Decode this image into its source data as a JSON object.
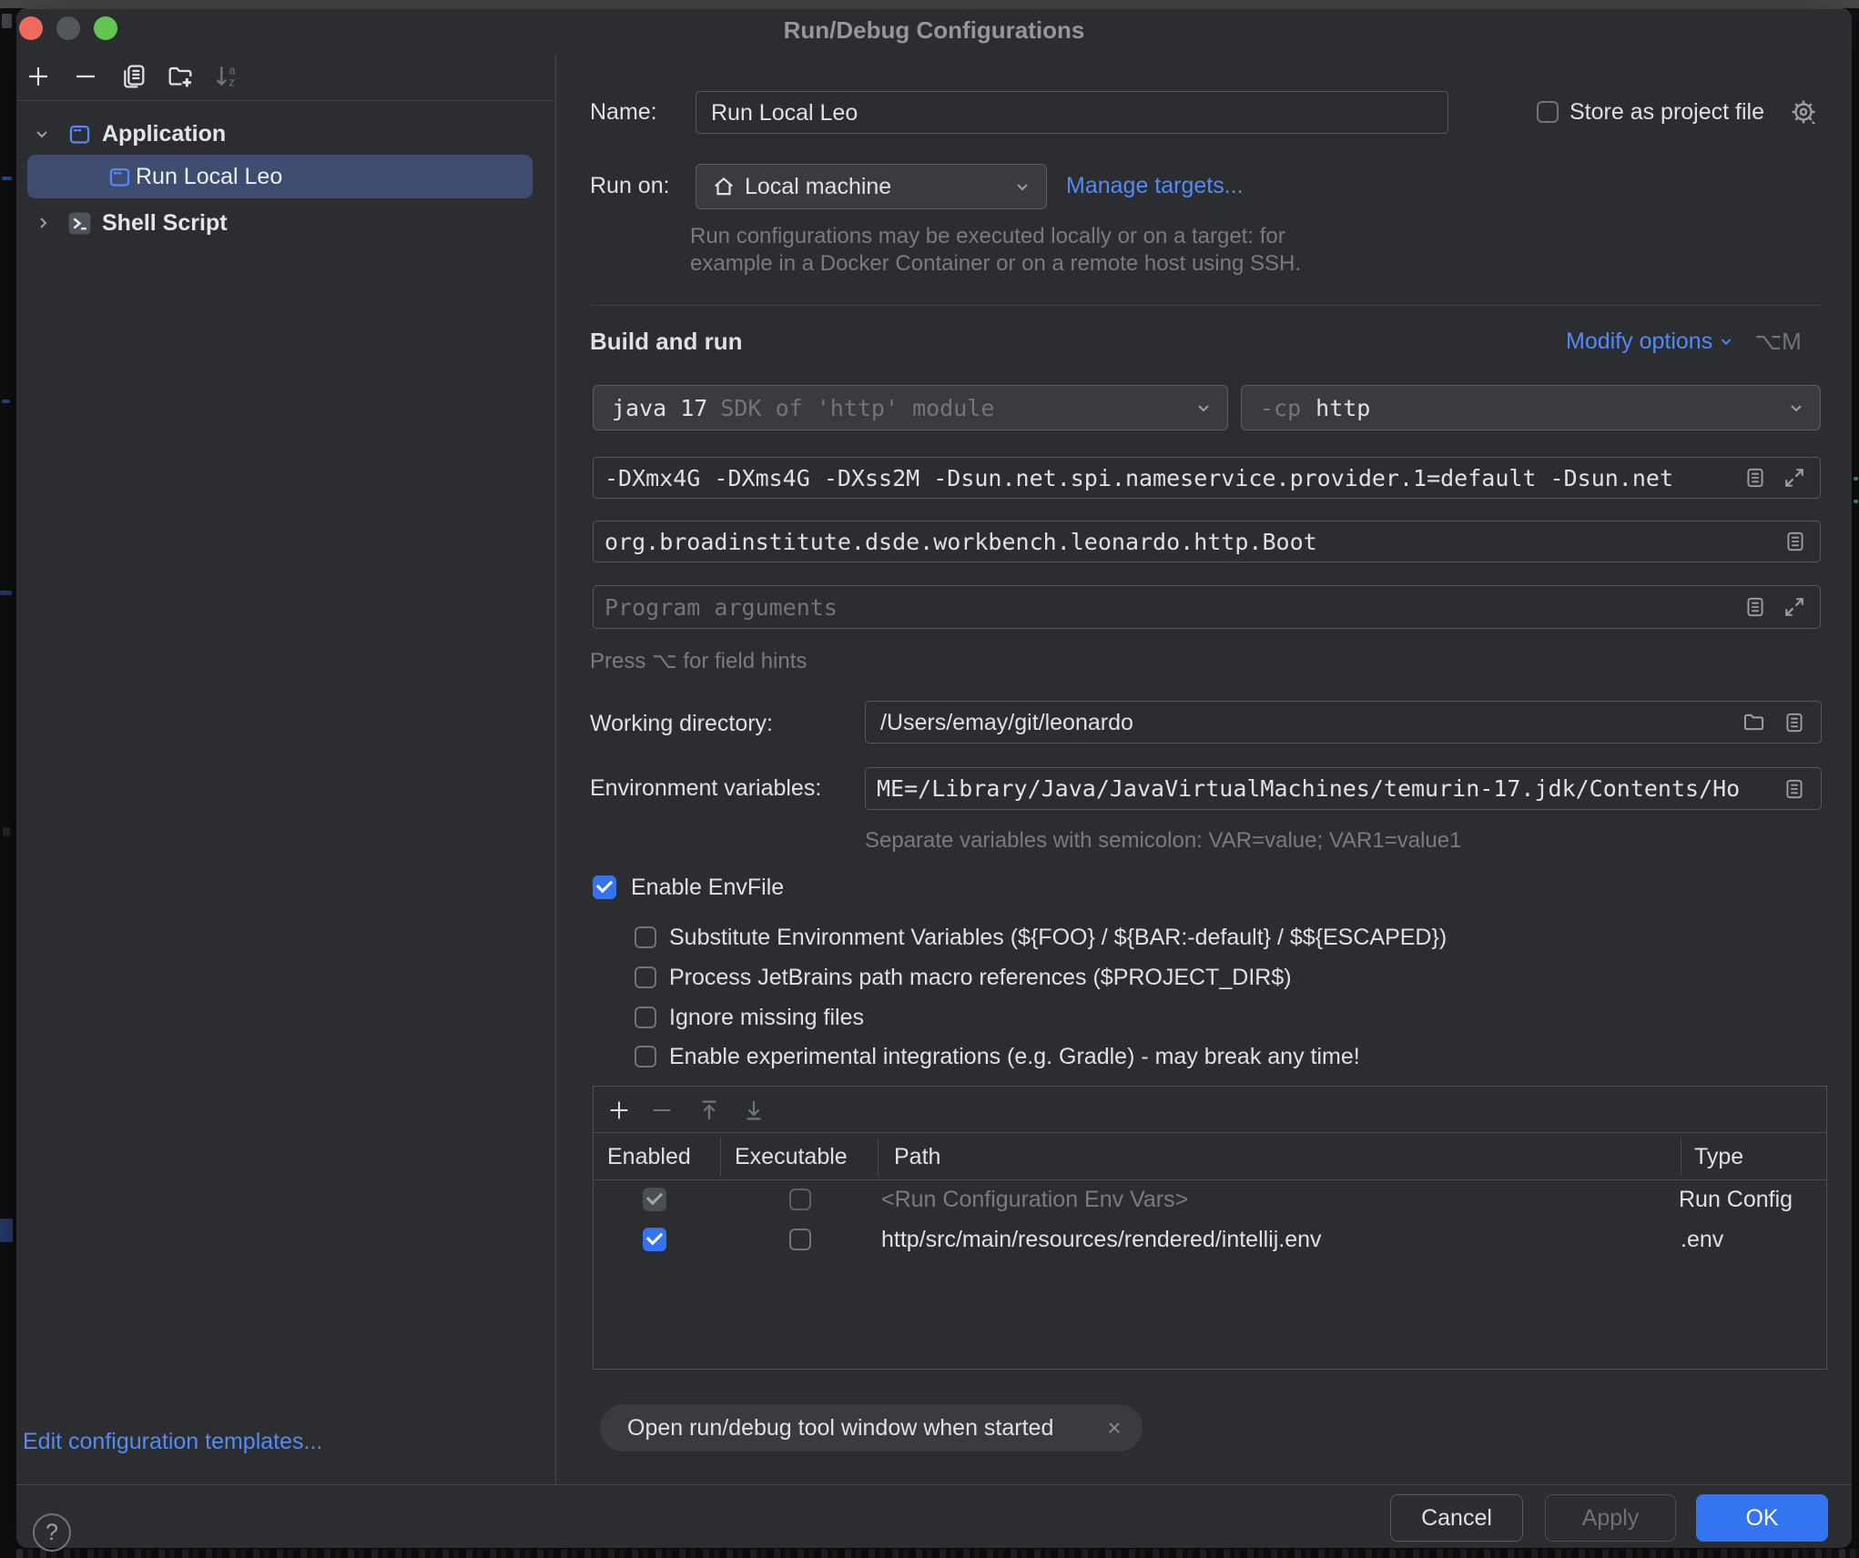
{
  "window": {
    "title": "Run/Debug Configurations",
    "traffic_lights": [
      "close",
      "minimize",
      "zoom"
    ]
  },
  "sidebar": {
    "toolbar": [
      {
        "icon": "add-icon"
      },
      {
        "icon": "remove-icon"
      },
      {
        "icon": "copy-icon"
      },
      {
        "icon": "new-folder-icon"
      },
      {
        "icon": "sort-alphabetically-icon"
      }
    ],
    "tree": [
      {
        "label": "Application",
        "icon": "application-icon",
        "expanded": true
      },
      {
        "label": "Run Local Leo",
        "icon": "application-icon",
        "selected": true
      },
      {
        "label": "Shell Script",
        "icon": "shell-script-icon",
        "expanded": false
      }
    ],
    "edit_templates_link": "Edit configuration templates..."
  },
  "form": {
    "name": {
      "label": "Name:",
      "value": "Run Local Leo"
    },
    "store_as_project_file": {
      "label": "Store as project file",
      "checked": false,
      "icon": "gear-icon"
    },
    "run_on": {
      "label": "Run on:",
      "value": "Local machine",
      "icon": "home-icon",
      "manage_link": "Manage targets...",
      "hint_line1": "Run configurations may be executed locally or on a target: for",
      "hint_line2": "example in a Docker Container or on a remote host using SSH."
    },
    "build_and_run": {
      "title": "Build and run",
      "modify_options": "Modify options",
      "shortcut": "⌥M"
    },
    "jdk": {
      "value": "java 17",
      "suffix": "SDK of 'http' module"
    },
    "classpath": {
      "prefix": "-cp",
      "value": "http"
    },
    "vm_options": "-DXmx4G -DXms4G -DXss2M -Dsun.net.spi.nameservice.provider.1=default -Dsun.net",
    "main_class": "org.broadinstitute.dsde.workbench.leonardo.http.Boot",
    "program_arguments_placeholder": "Program arguments",
    "field_hints": "Press ⌥ for field hints",
    "working_directory": {
      "label": "Working directory:",
      "value": "/Users/emay/git/leonardo"
    },
    "environment_variables": {
      "label": "Environment variables:",
      "value": "ME=/Library/Java/JavaVirtualMachines/temurin-17.jdk/Contents/Ho",
      "hint": "Separate variables with semicolon: VAR=value; VAR1=value1"
    },
    "envfile": {
      "enable": {
        "label": "Enable EnvFile",
        "checked": true
      },
      "options": [
        {
          "label": "Substitute Environment Variables (${FOO} / ${BAR:-default} / $${ESCAPED})",
          "checked": false
        },
        {
          "label": "Process JetBrains path macro references ($PROJECT_DIR$)",
          "checked": false
        },
        {
          "label": "Ignore missing files",
          "checked": false
        },
        {
          "label": "Enable experimental integrations (e.g. Gradle) - may break any time!",
          "checked": false
        }
      ],
      "table": {
        "columns": [
          "Enabled",
          "Executable",
          "Path",
          "Type"
        ],
        "rows": [
          {
            "enabled": true,
            "executable": false,
            "path": "<Run Configuration Env Vars>",
            "type": "Run Config",
            "muted": true
          },
          {
            "enabled": true,
            "executable": false,
            "path": "http/src/main/resources/rendered/intellij.env",
            "type": ".env",
            "muted": false
          }
        ]
      }
    },
    "before_launch_chip": "Open run/debug tool window when started"
  },
  "footer": {
    "help": "?",
    "cancel": "Cancel",
    "apply": "Apply",
    "ok": "OK"
  },
  "colors": {
    "accent": "#3574f0",
    "link": "#548af7",
    "selection_row": "#3e4c70",
    "dialog_bg": "#2b2d30"
  }
}
